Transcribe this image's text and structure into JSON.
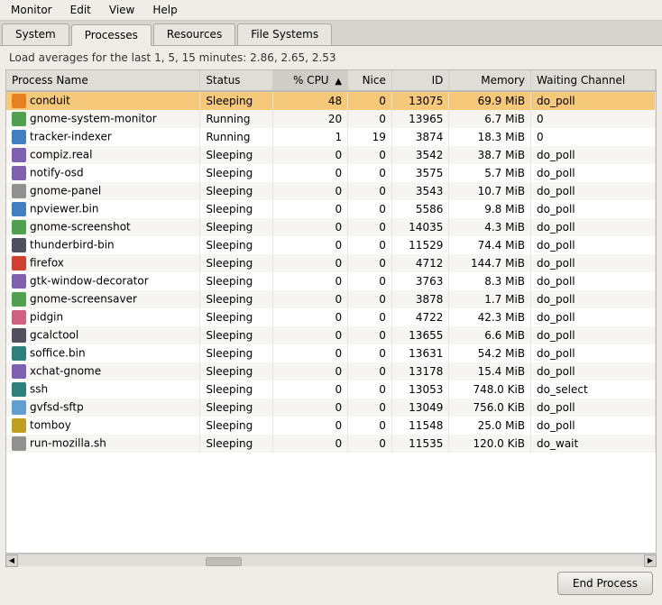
{
  "menubar": {
    "items": [
      "Monitor",
      "Edit",
      "View",
      "Help"
    ]
  },
  "tabs": {
    "items": [
      "System",
      "Processes",
      "Resources",
      "File Systems"
    ],
    "active": "Processes"
  },
  "statusbar": {
    "text": "Load averages for the last 1, 5, 15 minutes: 2.86, 2.65, 2.53"
  },
  "table": {
    "columns": [
      {
        "label": "Process Name",
        "key": "name"
      },
      {
        "label": "Status",
        "key": "status"
      },
      {
        "label": "% CPU",
        "key": "cpu",
        "sorted": true,
        "dir": "desc"
      },
      {
        "label": "Nice",
        "key": "nice"
      },
      {
        "label": "ID",
        "key": "id"
      },
      {
        "label": "Memory",
        "key": "memory"
      },
      {
        "label": "Waiting Channel",
        "key": "waiting"
      }
    ],
    "rows": [
      {
        "name": "conduit",
        "status": "Sleeping",
        "cpu": "48",
        "nice": "0",
        "id": "13075",
        "memory": "69.9 MiB",
        "waiting": "do_poll",
        "selected": true,
        "icon": "ico-orange"
      },
      {
        "name": "gnome-system-monitor",
        "status": "Running",
        "cpu": "20",
        "nice": "0",
        "id": "13965",
        "memory": "6.7 MiB",
        "waiting": "0",
        "selected": false,
        "icon": "ico-green"
      },
      {
        "name": "tracker-indexer",
        "status": "Running",
        "cpu": "1",
        "nice": "19",
        "id": "3874",
        "memory": "18.3 MiB",
        "waiting": "0",
        "selected": false,
        "icon": "ico-blue"
      },
      {
        "name": "compiz.real",
        "status": "Sleeping",
        "cpu": "0",
        "nice": "0",
        "id": "3542",
        "memory": "38.7 MiB",
        "waiting": "do_poll",
        "selected": false,
        "icon": "ico-purple"
      },
      {
        "name": "notify-osd",
        "status": "Sleeping",
        "cpu": "0",
        "nice": "0",
        "id": "3575",
        "memory": "5.7 MiB",
        "waiting": "do_poll",
        "selected": false,
        "icon": "ico-purple"
      },
      {
        "name": "gnome-panel",
        "status": "Sleeping",
        "cpu": "0",
        "nice": "0",
        "id": "3543",
        "memory": "10.7 MiB",
        "waiting": "do_poll",
        "selected": false,
        "icon": "ico-gray"
      },
      {
        "name": "npviewer.bin",
        "status": "Sleeping",
        "cpu": "0",
        "nice": "0",
        "id": "5586",
        "memory": "9.8 MiB",
        "waiting": "do_poll",
        "selected": false,
        "icon": "ico-blue"
      },
      {
        "name": "gnome-screenshot",
        "status": "Sleeping",
        "cpu": "0",
        "nice": "0",
        "id": "14035",
        "memory": "4.3 MiB",
        "waiting": "do_poll",
        "selected": false,
        "icon": "ico-green"
      },
      {
        "name": "thunderbird-bin",
        "status": "Sleeping",
        "cpu": "0",
        "nice": "0",
        "id": "11529",
        "memory": "74.4 MiB",
        "waiting": "do_poll",
        "selected": false,
        "icon": "ico-dark"
      },
      {
        "name": "firefox",
        "status": "Sleeping",
        "cpu": "0",
        "nice": "0",
        "id": "4712",
        "memory": "144.7 MiB",
        "waiting": "do_poll",
        "selected": false,
        "icon": "ico-red"
      },
      {
        "name": "gtk-window-decorator",
        "status": "Sleeping",
        "cpu": "0",
        "nice": "0",
        "id": "3763",
        "memory": "8.3 MiB",
        "waiting": "do_poll",
        "selected": false,
        "icon": "ico-purple"
      },
      {
        "name": "gnome-screensaver",
        "status": "Sleeping",
        "cpu": "0",
        "nice": "0",
        "id": "3878",
        "memory": "1.7 MiB",
        "waiting": "do_poll",
        "selected": false,
        "icon": "ico-green"
      },
      {
        "name": "pidgin",
        "status": "Sleeping",
        "cpu": "0",
        "nice": "0",
        "id": "4722",
        "memory": "42.3 MiB",
        "waiting": "do_poll",
        "selected": false,
        "icon": "ico-pink"
      },
      {
        "name": "gcalctool",
        "status": "Sleeping",
        "cpu": "0",
        "nice": "0",
        "id": "13655",
        "memory": "6.6 MiB",
        "waiting": "do_poll",
        "selected": false,
        "icon": "ico-dark"
      },
      {
        "name": "soffice.bin",
        "status": "Sleeping",
        "cpu": "0",
        "nice": "0",
        "id": "13631",
        "memory": "54.2 MiB",
        "waiting": "do_poll",
        "selected": false,
        "icon": "ico-teal"
      },
      {
        "name": "xchat-gnome",
        "status": "Sleeping",
        "cpu": "0",
        "nice": "0",
        "id": "13178",
        "memory": "15.4 MiB",
        "waiting": "do_poll",
        "selected": false,
        "icon": "ico-purple"
      },
      {
        "name": "ssh",
        "status": "Sleeping",
        "cpu": "0",
        "nice": "0",
        "id": "13053",
        "memory": "748.0 KiB",
        "waiting": "do_select",
        "selected": false,
        "icon": "ico-teal"
      },
      {
        "name": "gvfsd-sftp",
        "status": "Sleeping",
        "cpu": "0",
        "nice": "0",
        "id": "13049",
        "memory": "756.0 KiB",
        "waiting": "do_poll",
        "selected": false,
        "icon": "ico-lightblue"
      },
      {
        "name": "tomboy",
        "status": "Sleeping",
        "cpu": "0",
        "nice": "0",
        "id": "11548",
        "memory": "25.0 MiB",
        "waiting": "do_poll",
        "selected": false,
        "icon": "ico-yellow"
      },
      {
        "name": "run-mozilla.sh",
        "status": "Sleeping",
        "cpu": "0",
        "nice": "0",
        "id": "11535",
        "memory": "120.0 KiB",
        "waiting": "do_wait",
        "selected": false,
        "icon": "ico-gray"
      }
    ]
  },
  "buttons": {
    "end_process": "End Process"
  }
}
